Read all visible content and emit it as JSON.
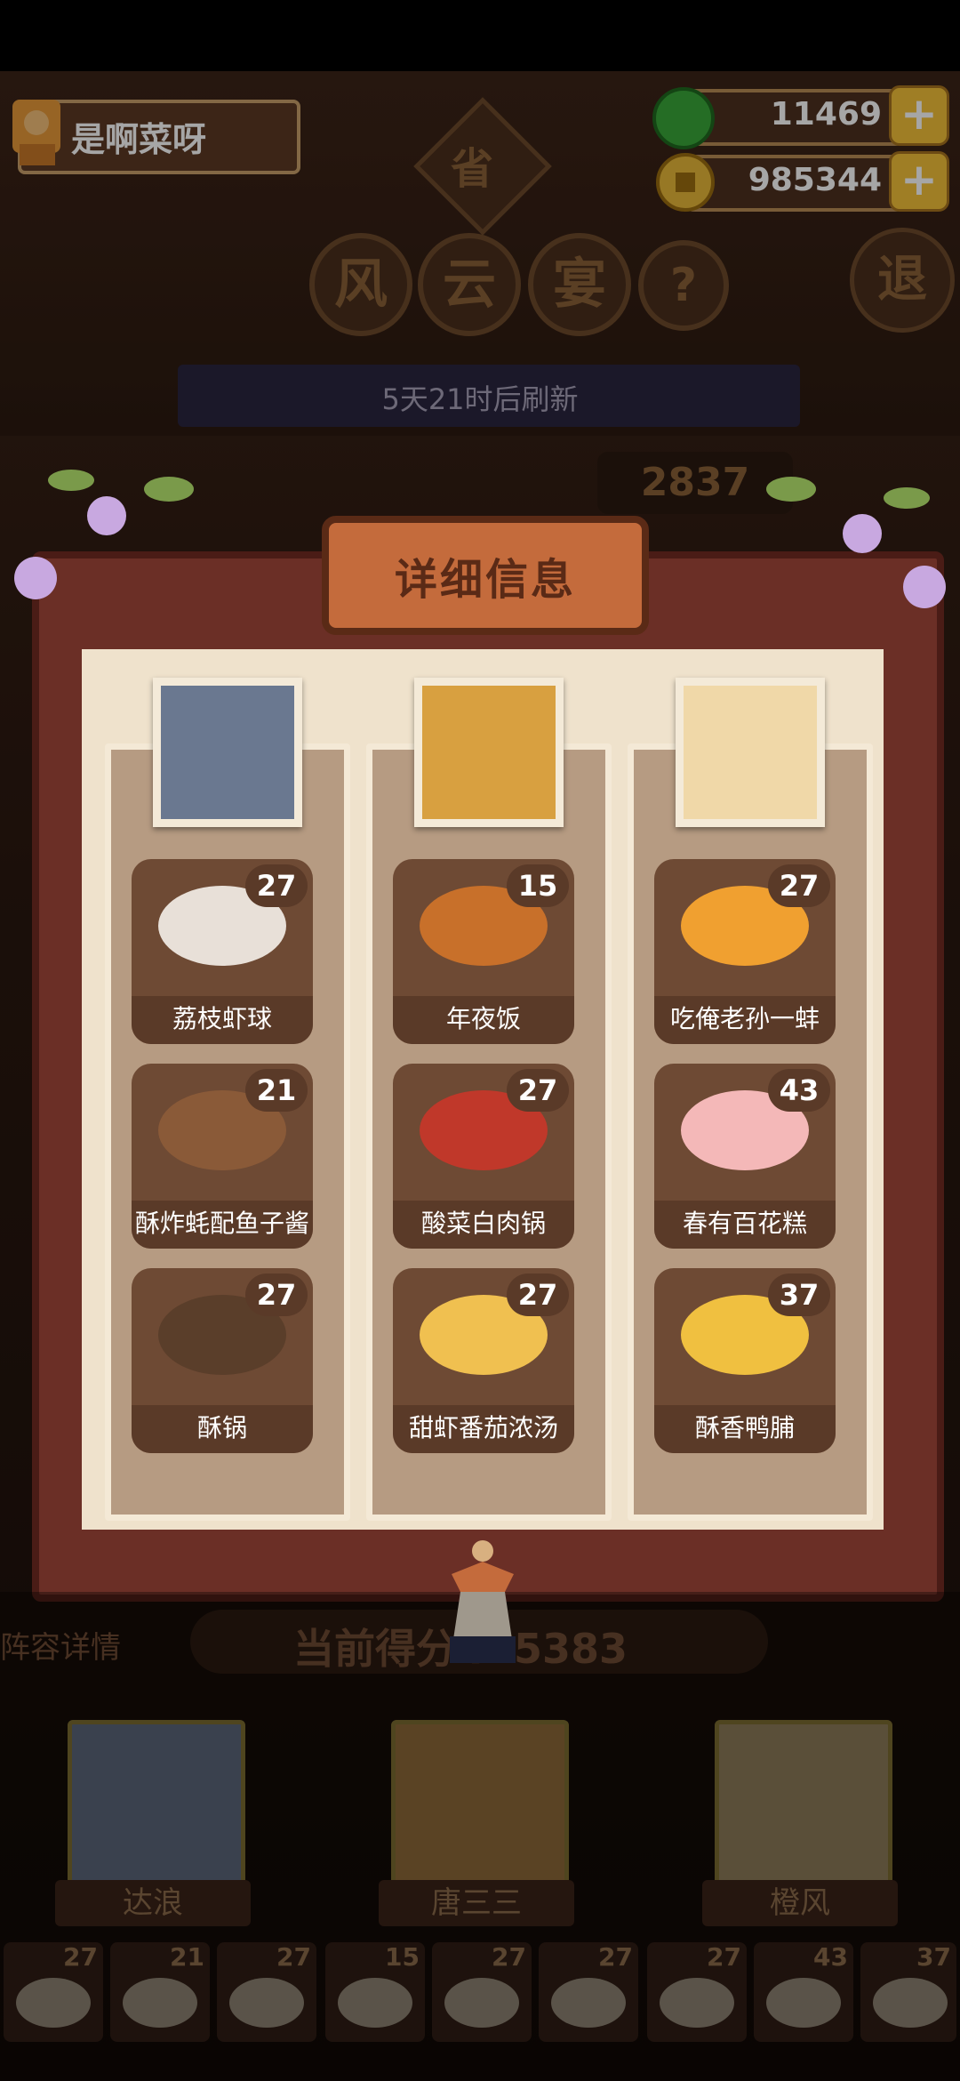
{
  "player": {
    "name": "是啊菜呀"
  },
  "currency": {
    "jade": "11469",
    "coins": "985344",
    "plus": "+"
  },
  "event": {
    "province": "省",
    "title_chars": [
      "风",
      "云",
      "宴"
    ],
    "help": "?",
    "refresh": "5天21时后刷新",
    "exit": "退",
    "score_ghost": "2837"
  },
  "modal": {
    "title": "详细信息",
    "columns": [
      {
        "dishes": [
          {
            "name": "荔枝虾球",
            "level": "27",
            "color": "#e8e0d8"
          },
          {
            "name": "酥炸蚝配鱼子酱",
            "level": "21",
            "color": "#8a5a38"
          },
          {
            "name": "酥锅",
            "level": "27",
            "color": "#5a3e2a"
          }
        ]
      },
      {
        "dishes": [
          {
            "name": "年夜饭",
            "level": "15",
            "color": "#c8702a"
          },
          {
            "name": "酸菜白肉锅",
            "level": "27",
            "color": "#c0382a"
          },
          {
            "name": "甜虾番茄浓汤",
            "level": "27",
            "color": "#f0c050"
          }
        ]
      },
      {
        "dishes": [
          {
            "name": "吃俺老孙一蚌",
            "level": "27",
            "color": "#f0a030"
          },
          {
            "name": "春有百花糕",
            "level": "43",
            "color": "#f4b8b8"
          },
          {
            "name": "酥香鸭脯",
            "level": "37",
            "color": "#f0c040"
          }
        ]
      }
    ]
  },
  "bottom": {
    "lineup_label": "阵容详情",
    "current_score": "当前得分475383",
    "heroes": [
      {
        "name": "达浪"
      },
      {
        "name": "唐三三"
      },
      {
        "name": "橙风"
      }
    ],
    "mini_levels": [
      "27",
      "21",
      "27",
      "15",
      "27",
      "27",
      "27",
      "43",
      "37"
    ]
  }
}
